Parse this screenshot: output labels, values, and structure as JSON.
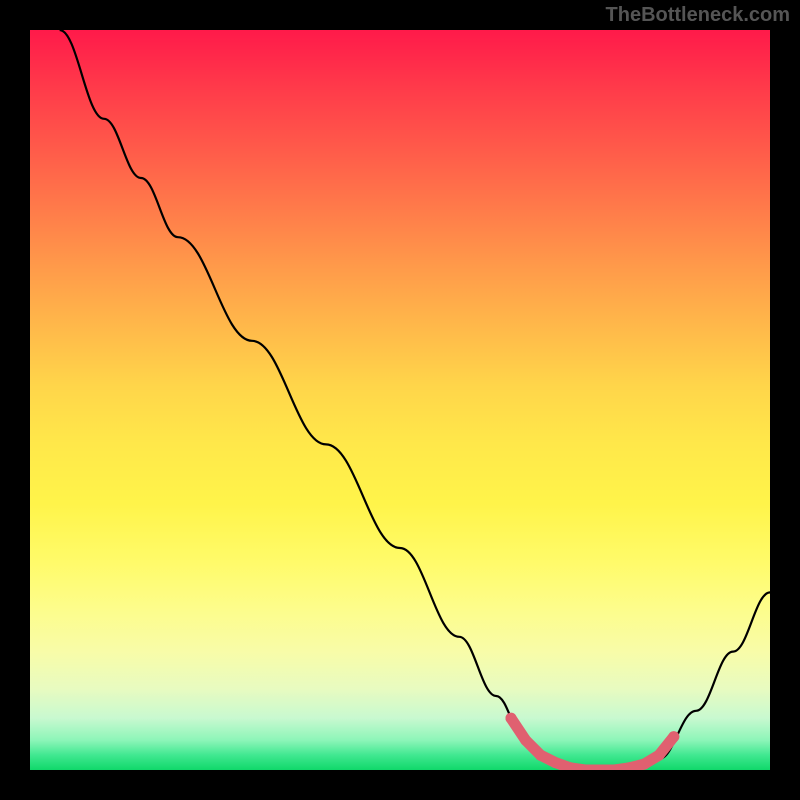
{
  "watermark": "TheBottleneck.com",
  "chart_data": {
    "type": "line",
    "title": "",
    "xlabel": "",
    "ylabel": "",
    "xlim": [
      0,
      100
    ],
    "ylim": [
      0,
      100
    ],
    "grid": false,
    "series": [
      {
        "name": "bottleneck-curve",
        "color": "#000000",
        "points": [
          {
            "x": 4,
            "y": 100
          },
          {
            "x": 10,
            "y": 88
          },
          {
            "x": 15,
            "y": 80
          },
          {
            "x": 20,
            "y": 72
          },
          {
            "x": 30,
            "y": 58
          },
          {
            "x": 40,
            "y": 44
          },
          {
            "x": 50,
            "y": 30
          },
          {
            "x": 58,
            "y": 18
          },
          {
            "x": 63,
            "y": 10
          },
          {
            "x": 67,
            "y": 4
          },
          {
            "x": 70,
            "y": 1
          },
          {
            "x": 75,
            "y": 0
          },
          {
            "x": 80,
            "y": 0
          },
          {
            "x": 85,
            "y": 1.5
          },
          {
            "x": 90,
            "y": 8
          },
          {
            "x": 95,
            "y": 16
          },
          {
            "x": 100,
            "y": 24
          }
        ]
      },
      {
        "name": "highlight-dots",
        "color": "#e06070",
        "points": [
          {
            "x": 65,
            "y": 7
          },
          {
            "x": 67,
            "y": 4
          },
          {
            "x": 69,
            "y": 2
          },
          {
            "x": 71,
            "y": 1
          },
          {
            "x": 73,
            "y": 0.3
          },
          {
            "x": 75,
            "y": 0
          },
          {
            "x": 77,
            "y": 0
          },
          {
            "x": 79,
            "y": 0
          },
          {
            "x": 81,
            "y": 0.3
          },
          {
            "x": 83,
            "y": 0.8
          },
          {
            "x": 85,
            "y": 2
          },
          {
            "x": 87,
            "y": 4.5
          }
        ]
      }
    ],
    "background_gradient": {
      "top": "#ff1a4a",
      "mid_upper": "#ff9a4a",
      "mid": "#fff44a",
      "mid_lower": "#f8fca8",
      "bottom": "#10d86a"
    }
  }
}
